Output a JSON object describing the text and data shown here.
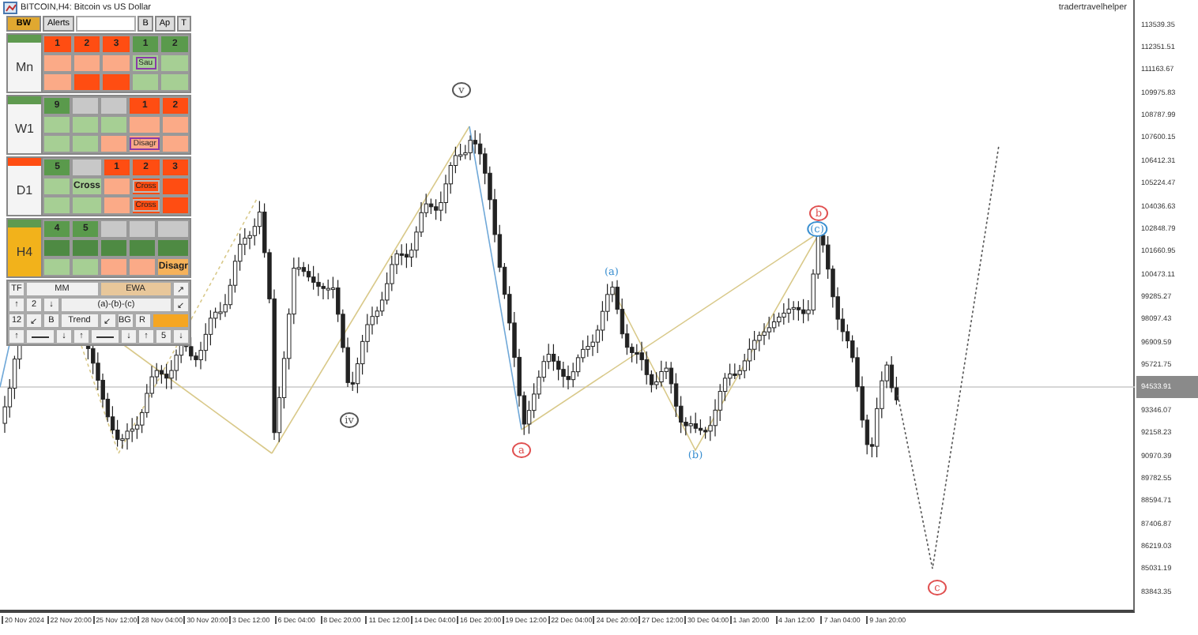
{
  "window": {
    "title": "BITCOIN,H4: Bitcoin vs US Dollar"
  },
  "account": "tradertravelhelper",
  "panel": {
    "header": [
      {
        "text": "BW",
        "kind": "tag"
      },
      {
        "text": "Alerts",
        "kind": "button"
      },
      {
        "kind": "field"
      },
      {
        "text": "B",
        "kind": "button"
      },
      {
        "text": "Ap",
        "kind": "button"
      },
      {
        "text": "T",
        "kind": "button"
      }
    ],
    "sections": [
      {
        "label": {
          "text": "Mn",
          "color": "#f4f4f4"
        },
        "bar": {
          "color": "#5f9a4f"
        },
        "rows": [
          [
            {
              "text": "1",
              "color": "#ff4d12",
              "kind": "plain"
            },
            {
              "text": "2",
              "color": "#ff4d12",
              "kind": "plain"
            },
            {
              "text": "3",
              "color": "#ff4d12",
              "kind": "plain"
            },
            {
              "text": "1",
              "color": "#5a9a4c",
              "kind": "plain"
            },
            {
              "text": "2",
              "color": "#5a9a4c",
              "kind": "plain"
            }
          ],
          [
            {
              "color": "#fbaa87",
              "kind": "plain"
            },
            {
              "color": "#fbaa87",
              "kind": "plain"
            },
            {
              "color": "#fbaa87",
              "kind": "plain"
            },
            {
              "text": "Sau",
              "color": "#a6cf94",
              "kind": "tag"
            },
            {
              "color": "#a6cf94",
              "kind": "plain"
            }
          ],
          [
            {
              "color": "#fbaa87",
              "kind": "plain"
            },
            {
              "color": "#ff4d12",
              "kind": "plain"
            },
            {
              "color": "#ff4d12",
              "kind": "plain"
            },
            {
              "color": "#a6cf94",
              "kind": "plain"
            },
            {
              "color": "#a6cf94",
              "kind": "plain"
            }
          ]
        ]
      },
      {
        "label": {
          "text": "W1",
          "color": "#f4f4f4"
        },
        "bar": {
          "color": "#5f9a4f"
        },
        "rows": [
          [
            {
              "text": "9",
              "color": "#5a9a4c",
              "kind": "plain"
            },
            {
              "color": "#c8c8c8",
              "kind": "plain"
            },
            {
              "color": "#c8c8c8",
              "kind": "plain"
            },
            {
              "text": "1",
              "color": "#ff4d12",
              "kind": "plain"
            },
            {
              "text": "2",
              "color": "#ff4d12",
              "kind": "plain"
            }
          ],
          [
            {
              "color": "#a6cf94",
              "kind": "plain"
            },
            {
              "color": "#a6cf94",
              "kind": "plain"
            },
            {
              "color": "#a6cf94",
              "kind": "plain"
            },
            {
              "color": "#fbaa87",
              "kind": "plain"
            },
            {
              "color": "#fbaa87",
              "kind": "plain"
            }
          ],
          [
            {
              "color": "#a6cf94",
              "kind": "plain"
            },
            {
              "color": "#a6cf94",
              "kind": "plain"
            },
            {
              "color": "#fbaa87",
              "kind": "plain"
            },
            {
              "text": "Disagr",
              "color": "#fbaa87",
              "kind": "tag"
            },
            {
              "color": "#fbaa87",
              "kind": "plain"
            }
          ]
        ]
      },
      {
        "label": {
          "text": "D1",
          "color": "#f4f4f4"
        },
        "bar": {
          "color": "#ff4d12"
        },
        "rows": [
          [
            {
              "text": "5",
              "color": "#5a9a4c",
              "kind": "plain"
            },
            {
              "color": "#c8c8c8",
              "kind": "plain"
            },
            {
              "text": "1",
              "color": "#ff4d12",
              "kind": "plain"
            },
            {
              "text": "2",
              "color": "#ff4d12",
              "kind": "plain"
            },
            {
              "text": "3",
              "color": "#ff4d12",
              "kind": "plain"
            }
          ],
          [
            {
              "color": "#a6cf94",
              "kind": "plain"
            },
            {
              "text": "Cross",
              "color": "#a6cf94",
              "kind": "plain"
            },
            {
              "color": "#fbaa87",
              "kind": "plain"
            },
            {
              "text": "Cross",
              "color": "#ff4d12",
              "kind": "chip"
            },
            {
              "color": "#ff4d12",
              "kind": "plain"
            }
          ],
          [
            {
              "color": "#a6cf94",
              "kind": "plain"
            },
            {
              "color": "#a6cf94",
              "kind": "plain"
            },
            {
              "color": "#fbaa87",
              "kind": "plain"
            },
            {
              "text": "Cross",
              "color": "#ff4d12",
              "kind": "chip"
            },
            {
              "color": "#ff4d12",
              "kind": "plain"
            }
          ]
        ]
      },
      {
        "label": {
          "text": "H4",
          "color": "#f2b21b"
        },
        "bar": {
          "color": "#5f9a4f"
        },
        "rows": [
          [
            {
              "text": "4",
              "color": "#5a9a4c",
              "kind": "plain"
            },
            {
              "text": "5",
              "color": "#5a9a4c",
              "kind": "plain"
            },
            {
              "color": "#c8c8c8",
              "kind": "plain"
            },
            {
              "color": "#c8c8c8",
              "kind": "plain"
            },
            {
              "color": "#c8c8c8",
              "kind": "plain"
            }
          ],
          [
            {
              "color": "#4e8a43",
              "kind": "plain"
            },
            {
              "color": "#4e8a43",
              "kind": "plain"
            },
            {
              "color": "#4e8a43",
              "kind": "plain"
            },
            {
              "color": "#4e8a43",
              "kind": "plain"
            },
            {
              "color": "#4e8a43",
              "kind": "plain"
            }
          ],
          [
            {
              "color": "#a6cf94",
              "kind": "plain"
            },
            {
              "color": "#a6cf94",
              "kind": "plain"
            },
            {
              "color": "#fbaa87",
              "kind": "plain"
            },
            {
              "color": "#fbaa87",
              "kind": "plain"
            },
            {
              "text": "Disagr",
              "color": "#f6b25a",
              "kind": "plain"
            }
          ]
        ]
      }
    ]
  },
  "toolbar": [
    [
      {
        "text": "TF",
        "kind": "key"
      },
      {
        "text": "MM",
        "kind": "tab",
        "selected": false
      },
      {
        "text": "EWA",
        "kind": "tab",
        "selected": true
      },
      {
        "text": "↗",
        "kind": "key"
      }
    ],
    [
      {
        "text": "↑",
        "kind": "key"
      },
      {
        "text": "2",
        "kind": "key"
      },
      {
        "text": "↓",
        "kind": "key"
      },
      {
        "text": "(a)-(b)-(c)",
        "kind": "wide"
      },
      {
        "text": "↙",
        "kind": "key"
      }
    ],
    [
      {
        "text": "12",
        "kind": "key"
      },
      {
        "text": "↙",
        "kind": "key"
      },
      {
        "text": "B",
        "kind": "key"
      },
      {
        "text": "Trend",
        "kind": "wide"
      },
      {
        "text": "↙",
        "kind": "key"
      },
      {
        "text": "BG",
        "kind": "key"
      },
      {
        "text": "R",
        "kind": "key"
      },
      {
        "kind": "swatch",
        "color": "#f5a623"
      }
    ],
    [
      {
        "text": "↑",
        "kind": "key"
      },
      {
        "kind": "line"
      },
      {
        "text": "↓",
        "kind": "key"
      },
      {
        "text": "↑",
        "kind": "key"
      },
      {
        "kind": "line"
      },
      {
        "text": "↓",
        "kind": "key"
      },
      {
        "text": "↑",
        "kind": "key"
      },
      {
        "text": "5",
        "kind": "key"
      },
      {
        "text": "↓",
        "kind": "key"
      }
    ]
  ],
  "wave_labels": [
    {
      "text": "v",
      "color": "#555555",
      "kind": "circle"
    },
    {
      "text": "b",
      "color": "#e05050",
      "kind": "circle"
    },
    {
      "text": "(c)",
      "color": "#3a8fd0",
      "kind": "circle"
    },
    {
      "text": "(a)",
      "color": "#3a8fd0",
      "kind": "plain"
    },
    {
      "text": "iv",
      "color": "#555555",
      "kind": "circle"
    },
    {
      "text": "a",
      "color": "#e05050",
      "kind": "circle"
    },
    {
      "text": "(b)",
      "color": "#3a8fd0",
      "kind": "plain"
    },
    {
      "text": "c",
      "color": "#e05050",
      "kind": "circle"
    }
  ],
  "price_axis": [
    {
      "text": "113539.35",
      "kind": "tick"
    },
    {
      "text": "112351.51",
      "kind": "tick"
    },
    {
      "text": "111163.67",
      "kind": "tick"
    },
    {
      "text": "109975.83",
      "kind": "tick"
    },
    {
      "text": "108787.99",
      "kind": "tick"
    },
    {
      "text": "107600.15",
      "kind": "tick"
    },
    {
      "text": "106412.31",
      "kind": "tick"
    },
    {
      "text": "105224.47",
      "kind": "tick"
    },
    {
      "text": "104036.63",
      "kind": "tick"
    },
    {
      "text": "102848.79",
      "kind": "tick"
    },
    {
      "text": "101660.95",
      "kind": "tick"
    },
    {
      "text": "100473.11",
      "kind": "tick"
    },
    {
      "text": "99285.27",
      "kind": "tick"
    },
    {
      "text": "98097.43",
      "kind": "tick"
    },
    {
      "text": "96909.59",
      "kind": "tick"
    },
    {
      "text": "95721.75",
      "kind": "tick"
    },
    {
      "text": "94533.91",
      "kind": "current"
    },
    {
      "text": "93346.07",
      "kind": "tick"
    },
    {
      "text": "92158.23",
      "kind": "tick"
    },
    {
      "text": "90970.39",
      "kind": "tick"
    },
    {
      "text": "89782.55",
      "kind": "tick"
    },
    {
      "text": "88594.71",
      "kind": "tick"
    },
    {
      "text": "87406.87",
      "kind": "tick"
    },
    {
      "text": "86219.03",
      "kind": "tick"
    },
    {
      "text": "85031.19",
      "kind": "tick"
    },
    {
      "text": "83843.35",
      "kind": "tick"
    }
  ],
  "time_axis": [
    "20 Nov 2024",
    "22 Nov 20:00",
    "25 Nov 12:00",
    "28 Nov 04:00",
    "30 Nov 20:00",
    "3 Dec 12:00",
    "6 Dec 04:00",
    "8 Dec 20:00",
    "11 Dec 12:00",
    "14 Dec 04:00",
    "16 Dec 20:00",
    "19 Dec 12:00",
    "22 Dec 04:00",
    "24 Dec 20:00",
    "27 Dec 12:00",
    "30 Dec 04:00",
    "1 Jan 20:00",
    "4 Jan 12:00",
    "7 Jan 04:00",
    "9 Jan 20:00"
  ]
}
